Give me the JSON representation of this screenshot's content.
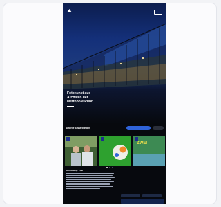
{
  "brand": {
    "logo_text": ""
  },
  "nav": {
    "items": [
      "",
      ""
    ],
    "menu_label": ""
  },
  "hero": {
    "kicker": "",
    "title_lines": [
      "Fotokunst aus",
      "Archiven der",
      "Metropole Ruhr"
    ]
  },
  "section": {
    "title": "Aktuelle Ausstellungen",
    "primary_button": "",
    "secondary_button": ""
  },
  "tiles": [
    {
      "name": "exhibition-tile-1",
      "color": "#3f5f34",
      "subtitle": ""
    },
    {
      "name": "exhibition-tile-2",
      "color": "#2ea12f",
      "subtitle": ""
    },
    {
      "name": "exhibition-tile-3",
      "color": "#3d8a53",
      "headline": "ZWEI",
      "subtitle": ""
    }
  ],
  "description": {
    "title": "Ausstellung: Titel"
  },
  "footer": {
    "logo_text": "",
    "button_label": ""
  },
  "colors": {
    "accent": "#2f63d9",
    "background": "#07090e",
    "hero_blue": "#14307a"
  }
}
